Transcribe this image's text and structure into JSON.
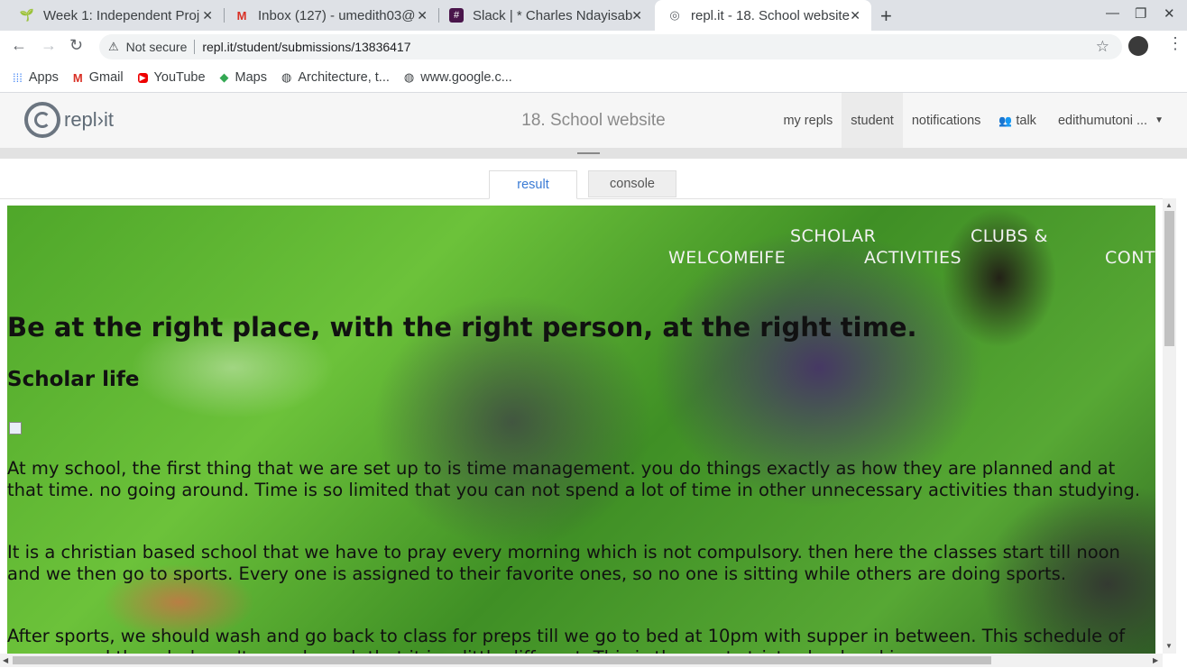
{
  "browser": {
    "tabs": [
      {
        "title": "Week 1: Independent Proj",
        "icon": "sprout-icon"
      },
      {
        "title": "Inbox (127) - umedith03@",
        "icon": "gmail-icon"
      },
      {
        "title": "Slack | * Charles Ndayisab",
        "icon": "slack-icon"
      },
      {
        "title": "repl.it - 18. School website",
        "icon": "replit-icon"
      }
    ],
    "address": {
      "security": "Not secure",
      "url": "repl.it/student/submissions/13836417"
    },
    "bookmarks": [
      {
        "label": "Apps",
        "icon": "apps-grid-icon"
      },
      {
        "label": "Gmail",
        "icon": "gmail-icon"
      },
      {
        "label": "YouTube",
        "icon": "youtube-icon"
      },
      {
        "label": "Maps",
        "icon": "maps-icon"
      },
      {
        "label": "Architecture, t...",
        "icon": "globe-icon"
      },
      {
        "label": "www.google.c...",
        "icon": "globe-icon"
      }
    ]
  },
  "repl": {
    "logo_text": "repl›it",
    "project_title": "18. School website",
    "nav": {
      "my_repls": "my repls",
      "student": "student",
      "notifications": "notifications",
      "talk": "talk",
      "user": "edithumutoni ..."
    },
    "result_tabs": {
      "result": "result",
      "console": "console"
    }
  },
  "site": {
    "nav": {
      "welcome": "WELCOME",
      "scholar_line1": "SCHOLAR",
      "scholar_line2": "LIFE",
      "clubs_line1": "CLUBS &",
      "clubs_line2": "ACTIVITIES",
      "contact": "CONT"
    },
    "headline": "Be at the right place, with the right person, at the right time.",
    "section_title": "Scholar life",
    "paragraphs": [
      "At my school, the first thing that we are set up to is time management. you do things exactly as how they are planned and at that time. no going around. Time is so limited that you can not spend a lot of time in other unnecessary activities than studying.",
      "It is a christian based school that we have to pray every morning which is not compulsory. then here the classes start till noon and we then go to sports. Every one is assigned to their favorite ones, so no one is sitting while others are doing sports.",
      "After sports, we should wash and go back to class for preps till we go to bed at 10pm with supper in between. This schedule of course, and though doesn't sound much that it is a little different. This is the most strict school and in"
    ]
  },
  "colors": {
    "result_tab_active": "#3a7bd5",
    "page_text": "#111111"
  }
}
